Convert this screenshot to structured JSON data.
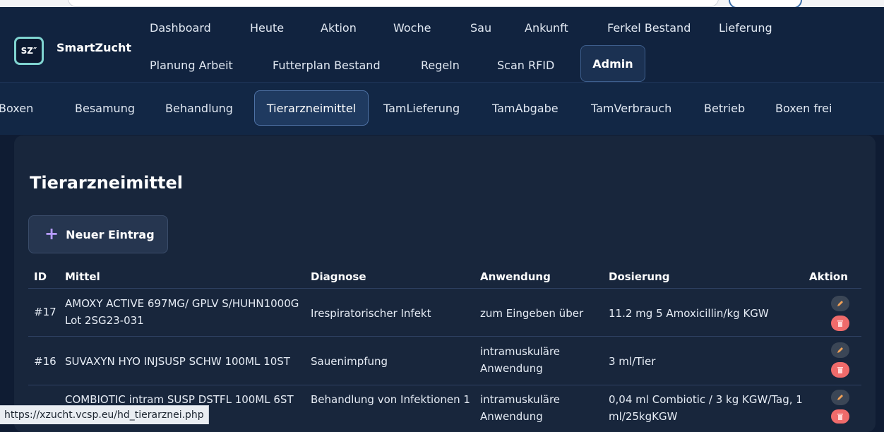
{
  "app": {
    "brand": "SmartZucht",
    "logo_text": "SZ″"
  },
  "main_nav": {
    "row1": [
      "Dashboard",
      "Heute",
      "Aktion",
      "Woche",
      "Sau",
      "Ankunft",
      "Ferkel Bestand",
      "Lieferung"
    ],
    "row2": [
      "Planung Arbeit",
      "Futterplan Bestand",
      "Regeln",
      "Scan RFID"
    ],
    "active": "Admin"
  },
  "sub_nav": {
    "items": [
      "Boxen",
      "Besamung",
      "Behandlung",
      "Tierarzneimittel",
      "TamLieferung",
      "TamAbgabe",
      "TamVerbrauch",
      "Betrieb",
      "Boxen frei"
    ],
    "active": "Tierarzneimittel"
  },
  "page": {
    "title": "Tierarzneimittel",
    "new_button": "Neuer Eintrag"
  },
  "table": {
    "headers": [
      "ID",
      "Mittel",
      "Diagnose",
      "Anwendung",
      "Dosierung",
      "Aktion"
    ],
    "rows": [
      {
        "id": "#17",
        "mittel": "AMOXY ACTIVE 697MG/ GPLV S/HUHN1000G Lot 2SG23-031",
        "diagnose": "Irespiratorischer Infekt",
        "anwendung": "zum Eingeben über",
        "dosierung": "11.2 mg 5 Amoxicillin/kg KGW"
      },
      {
        "id": "#16",
        "mittel": "SUVAXYN HYO INJSUSP SCHW 100ML 10ST",
        "diagnose": "Sauenimpfung",
        "anwendung": "intramuskuläre Anwendung",
        "dosierung": "3 ml/Tier"
      },
      {
        "id": "",
        "mittel": "COMBIOTIC intram SUSP DSTFL 100ML 6ST",
        "diagnose": "Behandlung von Infektionen 1",
        "anwendung": "intramuskuläre Anwendung",
        "dosierung": "0,04 ml Combiotic / 3 kg KGW/Tag, 1 ml/25kgKGW"
      }
    ]
  },
  "status_bar": {
    "url": "https://xzucht.vcsp.eu/hd_tierarznei.php"
  },
  "colors": {
    "background": "#0f1c33",
    "accent_delete": "#ef6b6b",
    "plus": "#b79cff"
  }
}
